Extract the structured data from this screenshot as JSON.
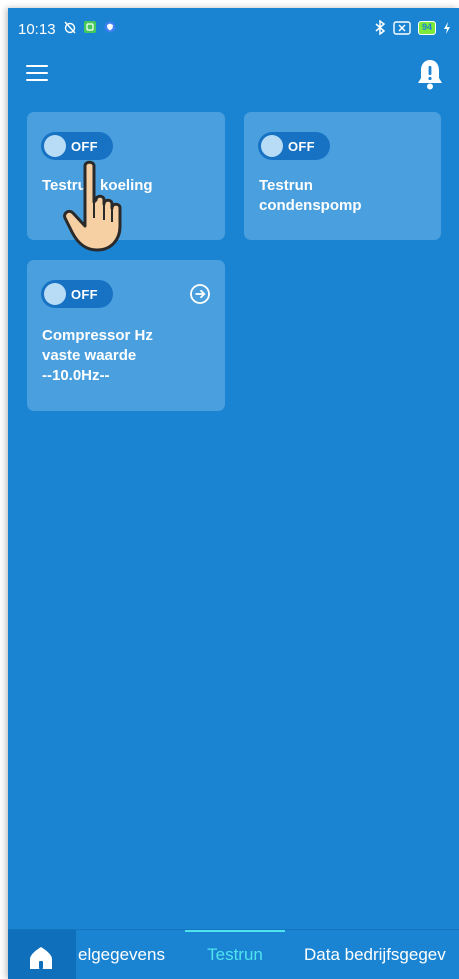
{
  "status_bar": {
    "time": "10:13",
    "battery": "94"
  },
  "header": {
    "menu_icon": "hamburger-menu-icon",
    "bell_icon": "bell-alert-icon"
  },
  "cards": [
    {
      "toggle_label": "OFF",
      "title": "Testrun koeling"
    },
    {
      "toggle_label": "OFF",
      "title_line1": "Testrun",
      "title_line2": "condenspomp"
    },
    {
      "toggle_label": "OFF",
      "title_line1": "Compressor Hz",
      "title_line2": "vaste waarde",
      "title_line3": "--10.0Hz--"
    }
  ],
  "tabs": {
    "home_icon": "home-icon",
    "items": [
      "elgegevens",
      "Testrun",
      "Data bedrijfsgegev"
    ],
    "active": "Testrun"
  },
  "colors": {
    "background": "#1a84d2",
    "card": "#4aa0de",
    "toggle": "#1772c4",
    "active_tab": "#4fe3ee"
  }
}
